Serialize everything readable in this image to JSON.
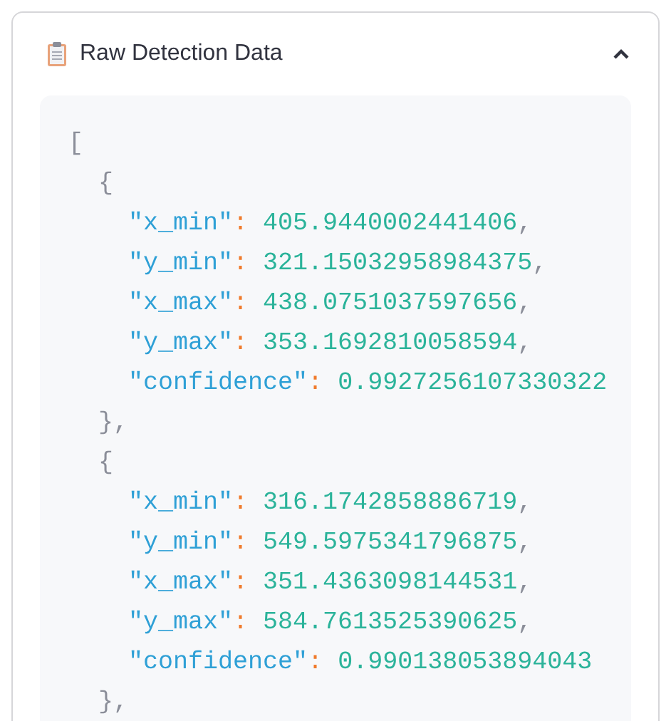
{
  "expander": {
    "title": "Raw Detection Data",
    "expanded": true,
    "code": {
      "open": "[",
      "items": [
        {
          "open": "{",
          "fields": [
            {
              "key": "\"x_min\"",
              "sep": ":",
              "value": "405.9440002441406",
              "comma": ","
            },
            {
              "key": "\"y_min\"",
              "sep": ":",
              "value": "321.15032958984375",
              "comma": ","
            },
            {
              "key": "\"x_max\"",
              "sep": ":",
              "value": "438.0751037597656",
              "comma": ","
            },
            {
              "key": "\"y_max\"",
              "sep": ":",
              "value": "353.1692810058594",
              "comma": ","
            },
            {
              "key": "\"confidence\"",
              "sep": ":",
              "value": "0.9927256107330322"
            }
          ],
          "close": "},"
        },
        {
          "open": "{",
          "fields": [
            {
              "key": "\"x_min\"",
              "sep": ":",
              "value": "316.1742858886719",
              "comma": ","
            },
            {
              "key": "\"y_min\"",
              "sep": ":",
              "value": "549.5975341796875",
              "comma": ","
            },
            {
              "key": "\"x_max\"",
              "sep": ":",
              "value": "351.4363098144531",
              "comma": ","
            },
            {
              "key": "\"y_max\"",
              "sep": ":",
              "value": "584.7613525390625",
              "comma": ","
            },
            {
              "key": "\"confidence\"",
              "sep": ":",
              "value": "0.990138053894043"
            }
          ],
          "close": "},"
        }
      ]
    }
  }
}
